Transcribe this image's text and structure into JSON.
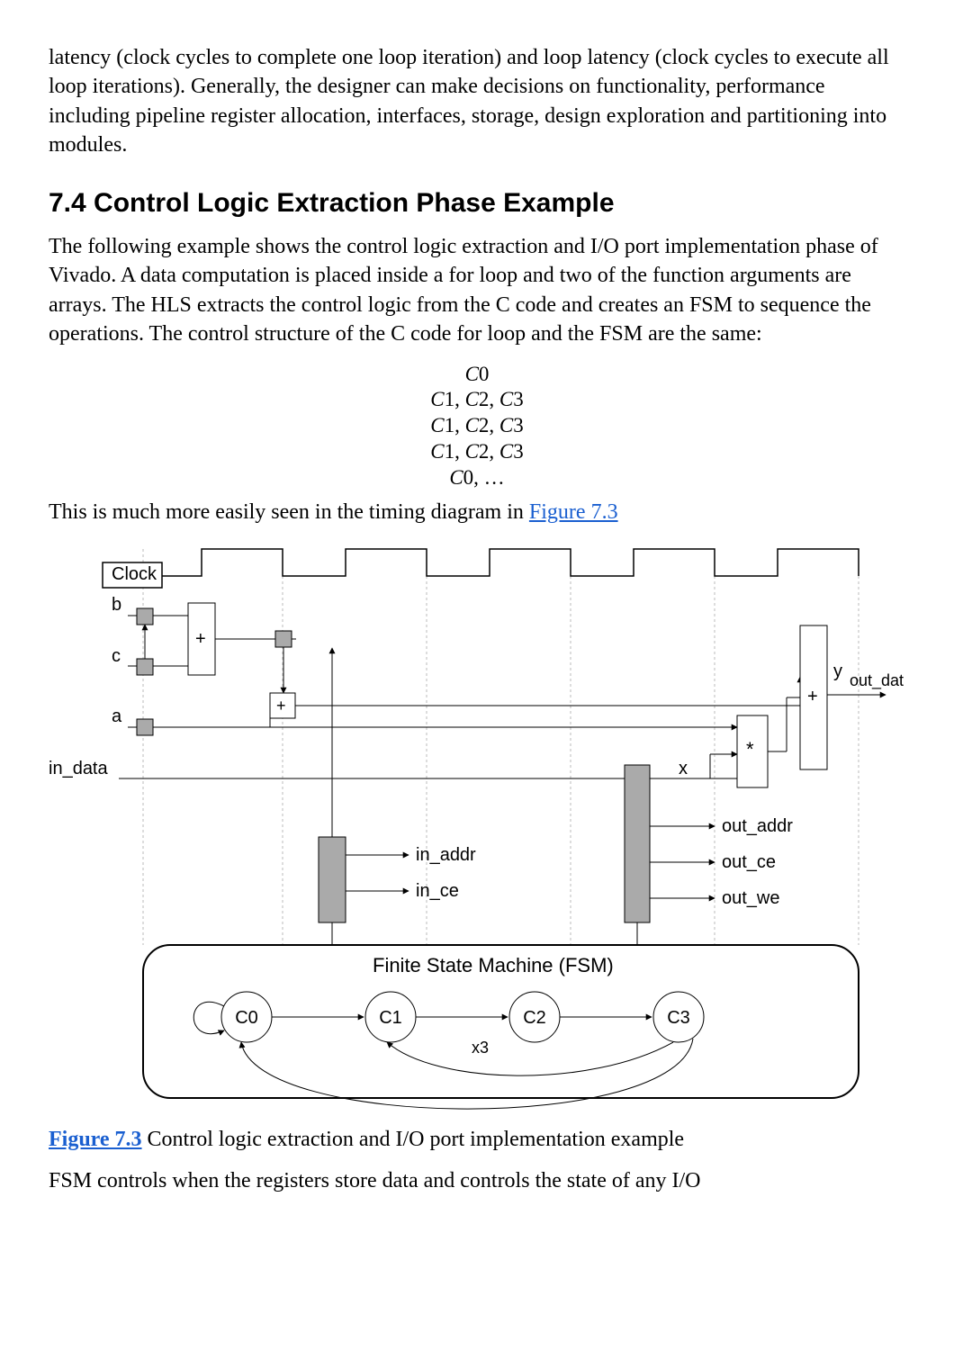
{
  "para1": "latency (clock cycles to complete one loop iteration) and loop latency (clock cycles to execute all loop iterations). Generally, the designer can make decisions on functionality, performance including pipeline register allocation, interfaces, storage, design exploration and partitioning into modules.",
  "heading": "7.4 Control Logic Extraction Phase Example",
  "para2": "The following example shows the control logic extraction and I/O port implementation phase of Vivado. A data computation is placed inside a for loop and two of the function arguments are arrays. The HLS extracts the control logic from the C code and creates an FSM to sequence the operations. The control structure of the C code for loop and the FSM are the same:",
  "eq": {
    "l1a": "C",
    "l1b": "0",
    "l2a": "C",
    "l2b": "1, ",
    "l2c": "C",
    "l2d": "2, ",
    "l2e": "C",
    "l2f": "3",
    "l5a": "C",
    "l5b": "0, …"
  },
  "para3a": "This is much more easily seen in the timing diagram in ",
  "para3link": "Figure 7.3",
  "fig": {
    "clock": "Clock",
    "b": "b",
    "c": "c",
    "a": "a",
    "in_data": "in_data",
    "in_addr": "in_addr",
    "in_ce": "in_ce",
    "x": "x",
    "y": "y",
    "out_data": "out_data",
    "out_addr": "out_addr",
    "out_ce": "out_ce",
    "out_we": "out_we",
    "fsm_title": "Finite State Machine (FSM)",
    "c0": "C0",
    "c1": "C1",
    "c2": "C2",
    "c3": "C3",
    "x3": "x3",
    "plus": "+",
    "star": "*"
  },
  "caption_link": "Figure 7.3",
  "caption_rest": " Control logic extraction and I/O port implementation example",
  "para4": "FSM controls when the registers store data and controls the state of any I/O"
}
